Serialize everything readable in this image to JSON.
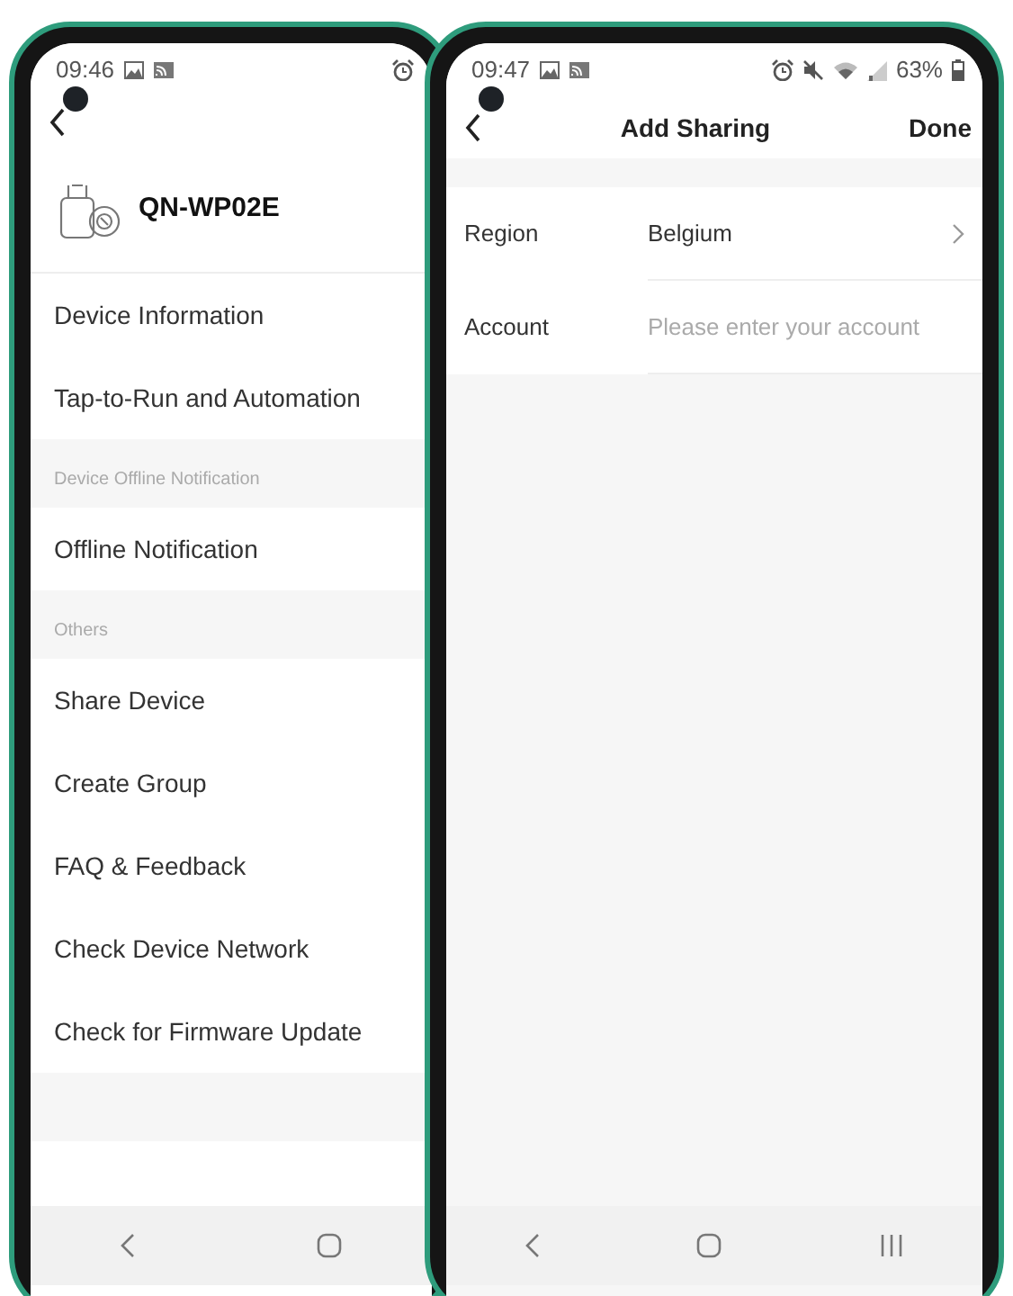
{
  "left_screen": {
    "status_bar": {
      "time": "09:46"
    },
    "device": {
      "name": "QN-WP02E"
    },
    "menu": [
      {
        "kind": "item",
        "label": "Device Information"
      },
      {
        "kind": "item",
        "label": "Tap-to-Run and Automation"
      },
      {
        "kind": "section",
        "label": "Device Offline Notification"
      },
      {
        "kind": "item",
        "label": "Offline Notification"
      },
      {
        "kind": "section",
        "label": "Others"
      },
      {
        "kind": "item",
        "label": "Share Device"
      },
      {
        "kind": "item",
        "label": "Create Group"
      },
      {
        "kind": "item",
        "label": "FAQ & Feedback"
      },
      {
        "kind": "item",
        "label": "Check Device Network"
      },
      {
        "kind": "item",
        "label": "Check for Firmware Update"
      },
      {
        "kind": "spacer"
      }
    ]
  },
  "right_screen": {
    "status_bar": {
      "time": "09:47",
      "battery": "63%"
    },
    "header": {
      "title": "Add Sharing",
      "action": "Done"
    },
    "form": [
      {
        "kind": "select",
        "label": "Region",
        "value": "Belgium"
      },
      {
        "kind": "input",
        "label": "Account",
        "placeholder": "Please enter your account"
      }
    ]
  }
}
